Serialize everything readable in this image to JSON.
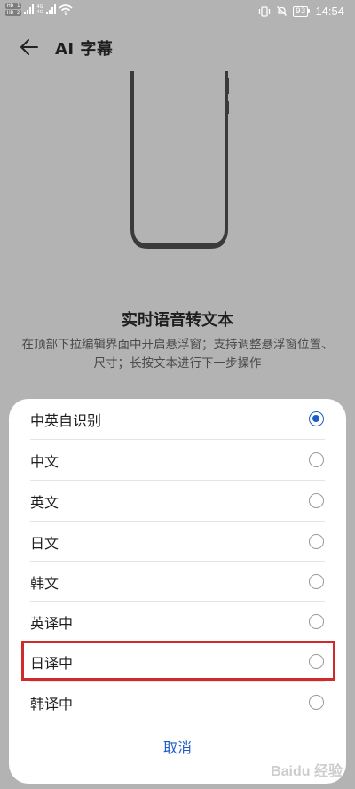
{
  "status_bar": {
    "sim1_tag": "HD 1",
    "sim2_tag": "HD 2",
    "net1": "4G",
    "net2": "4G",
    "battery": "93",
    "time": "14:54"
  },
  "header": {
    "title": "AI 字幕"
  },
  "intro": {
    "title": "实时语音转文本",
    "description": "在顶部下拉编辑界面中开启悬浮窗；支持调整悬浮窗位置、尺寸；长按文本进行下一步操作"
  },
  "language_sheet": {
    "options": [
      {
        "label": "中英自识别",
        "selected": true
      },
      {
        "label": "中文",
        "selected": false
      },
      {
        "label": "英文",
        "selected": false
      },
      {
        "label": "日文",
        "selected": false
      },
      {
        "label": "韩文",
        "selected": false
      },
      {
        "label": "英译中",
        "selected": false
      },
      {
        "label": "日译中",
        "selected": false
      },
      {
        "label": "韩译中",
        "selected": false
      }
    ],
    "cancel_label": "取消"
  },
  "colors": {
    "accent": "#1f5dc6",
    "highlight": "#cf2b2b",
    "background": "#b3b3b3"
  },
  "watermark": "Baidu 经验"
}
